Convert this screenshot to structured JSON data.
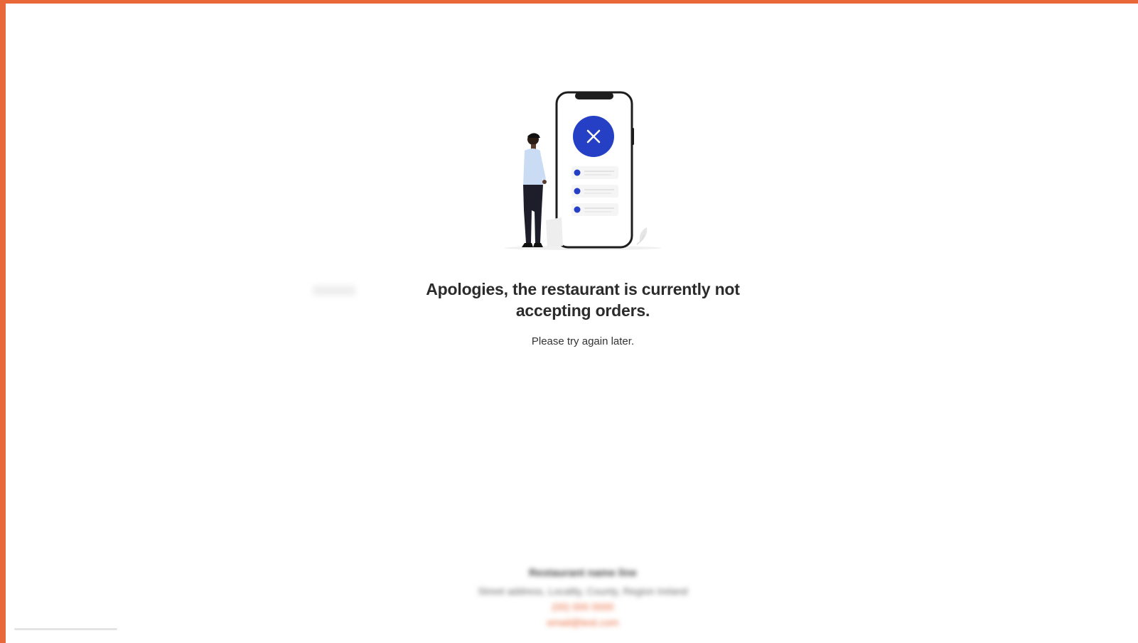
{
  "message": {
    "headline": "Apologies, the restaurant is currently not accepting orders.",
    "subline": "Please try again later."
  },
  "footer": {
    "restaurant_name": "Restaurant name line",
    "address": "Street address, Locality, County, Region Ireland",
    "phone": "(00) 000 0000",
    "email": "email@test.com"
  },
  "illustration": {
    "icon": "close-icon",
    "accent_color": "#2540c4"
  },
  "theme": {
    "frame_color": "#e8683a"
  }
}
